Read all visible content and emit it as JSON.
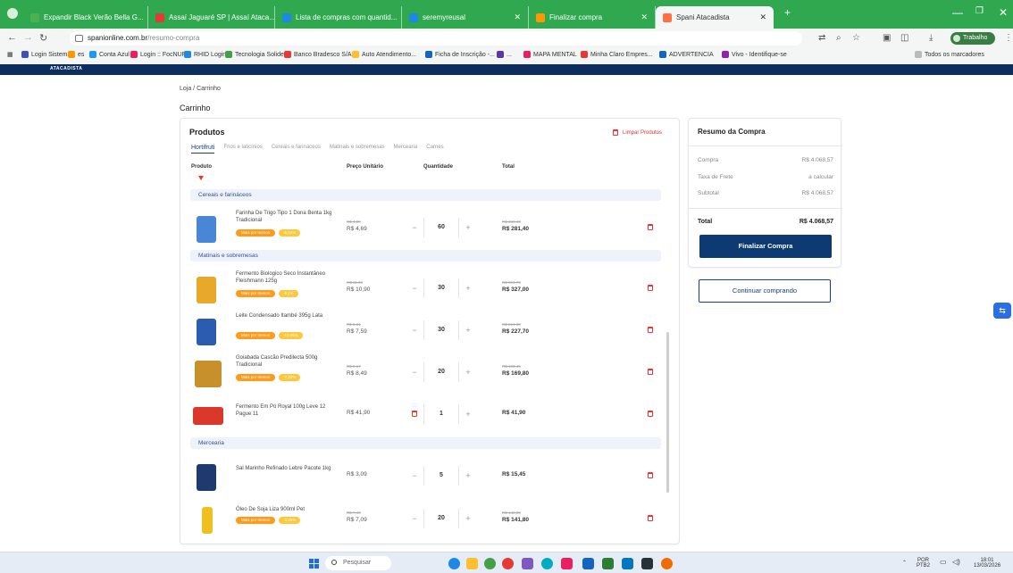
{
  "browser": {
    "tabs": [
      {
        "label": "Expandir Black Verão Bella G...",
        "color": "#4caf50"
      },
      {
        "label": "Assaí Jaguaré SP | Assaí Ataca...",
        "color": "#e53935"
      },
      {
        "label": "Lista de compras com quantid...",
        "color": "#1e88e5"
      },
      {
        "label": "seremyreusal",
        "color": "#1e88e5"
      },
      {
        "label": "Finalizar compra",
        "color": "#ff9800"
      },
      {
        "label": "Spani Atacadista",
        "color": "#ff7043"
      }
    ],
    "url_domain": "spanionline.com.br",
    "url_path": "/resumo-compra",
    "profile_label": "Trabalho",
    "bookmarks": [
      {
        "label": "Login Sistema",
        "color": "#3f51b5"
      },
      {
        "label": "es",
        "color": "#ff9800"
      },
      {
        "label": "Conta Azul",
        "color": "#2196f3"
      },
      {
        "label": "Login :: FocNUP",
        "color": "#e91e63"
      },
      {
        "label": "RHID Login",
        "color": "#1e88e5"
      },
      {
        "label": "Tecnologia Solides",
        "color": "#43a047"
      },
      {
        "label": "Banco Bradesco S/A",
        "color": "#e53935"
      },
      {
        "label": "Auto Atendimento...",
        "color": "#fbc02d"
      },
      {
        "label": "Ficha de Inscrição -...",
        "color": "#1565c0"
      },
      {
        "label": "...",
        "color": "#5e35b1"
      },
      {
        "label": "MAPA MENTAL",
        "color": "#e91e63"
      },
      {
        "label": "Minha Claro Empres...",
        "color": "#e53935"
      },
      {
        "label": "ADVERTENCIA",
        "color": "#1565c0"
      },
      {
        "label": "Vivo - Identifique-se",
        "color": "#8e24aa"
      }
    ],
    "bookmarks_all": "Todos os marcadores",
    "site_logo": "ATACADISTA"
  },
  "page": {
    "breadcrumb": "Loja / Carrinho",
    "title": "Carrinho"
  },
  "products": {
    "title": "Produtos",
    "clear_label": "Limpar Produtos",
    "tabs": [
      "Hortifruti",
      "Frios e laticínios",
      "Cereais e farináceos",
      "Matinais e sobremesas",
      "Mercearia",
      "Carnes"
    ],
    "columns": {
      "product": "Produto",
      "unit_price": "Preço Unitário",
      "quantity": "Quantidade",
      "total": "Total"
    },
    "sections": {
      "cereais": "Cereais e farináceos",
      "matinais": "Matinais e sobremesas",
      "mercearia": "Mercearia"
    },
    "items": [
      {
        "name": "Farinha De Trigo Tipo 1 Dona Benta 1kg Tradicional",
        "tag1": "Mais por menos",
        "tag2": "-6,01%",
        "old_price": "R$ 4,99",
        "price": "R$ 4,69",
        "qty": "60",
        "old_total": "R$ 299,40",
        "total": "R$ 281,40",
        "img_color": "#4a86d6"
      },
      {
        "name": "Fermento Biologico Seco Instantâneo Fleishmann 125g",
        "tag1": "Mais por menos",
        "tag2": "-9,1%",
        "old_price": "R$ 11,99",
        "price": "R$ 10,90",
        "qty": "30",
        "old_total": "R$ 359,70",
        "total": "R$ 327,00",
        "img_color": "#e8a82a"
      },
      {
        "name": "Leite Condensado Itambé 395g Lata",
        "tag1": "Mais por menos",
        "tag2": "-13,95%",
        "old_price": "R$ 8,81",
        "price": "R$ 7,59",
        "qty": "30",
        "old_total": "R$ 264,30",
        "total": "R$ 227,70",
        "img_color": "#2a5db0"
      },
      {
        "name": "Goiabada Cascão Predilecta 500g Tradicional",
        "tag1": "Mais por menos",
        "tag2": "-7,42%",
        "old_price": "R$ 9,17",
        "price": "R$ 8,49",
        "qty": "20",
        "old_total": "R$ 183,40",
        "total": "R$ 169,80",
        "img_color": "#c8902a"
      },
      {
        "name": "Fermento Em Pó Royal 100g Leve 12 Pague 11",
        "price": "R$ 41,90",
        "qty": "1",
        "total": "R$ 41,90",
        "img_color": "#d9382b"
      },
      {
        "name": "Sal Marinho Refinado Lebre Pacote 1kg",
        "price": "R$ 3,09",
        "qty": "5",
        "total": "R$ 15,45",
        "img_color": "#1e3a6e"
      },
      {
        "name": "Óleo De Soja Liza 900ml Pet",
        "tag1": "Mais por menos",
        "tag2": "-4,28%",
        "old_price": "R$ 7,40",
        "price": "R$ 7,09",
        "qty": "20",
        "old_total": "R$ 148,00",
        "total": "R$ 141,80",
        "img_color": "#f0c020"
      }
    ]
  },
  "summary": {
    "title": "Resumo da Compra",
    "rows": [
      {
        "label": "Compra",
        "value": "R$ 4.068,57"
      },
      {
        "label": "Taxa de Frete",
        "value": "a calcular"
      },
      {
        "label": "Subtotal",
        "value": "R$ 4.068,57"
      }
    ],
    "total_label": "Total",
    "total_value": "R$ 4.068,57",
    "finish_label": "Finalizar Compra",
    "continue_label": "Continuar comprando"
  },
  "taskbar": {
    "search_placeholder": "Pesquisar",
    "lang": "POR",
    "lang2": "PTB2",
    "time": "18:01",
    "date": "13/03/2026",
    "icon_colors": [
      "#1e88e5",
      "#fbc02d",
      "#43a047",
      "#e53935",
      "#7e57c2",
      "#00acc1",
      "#e91e63",
      "#1565c0",
      "#2e7d32",
      "#0277bd",
      "#263238",
      "#ef6c00"
    ]
  }
}
